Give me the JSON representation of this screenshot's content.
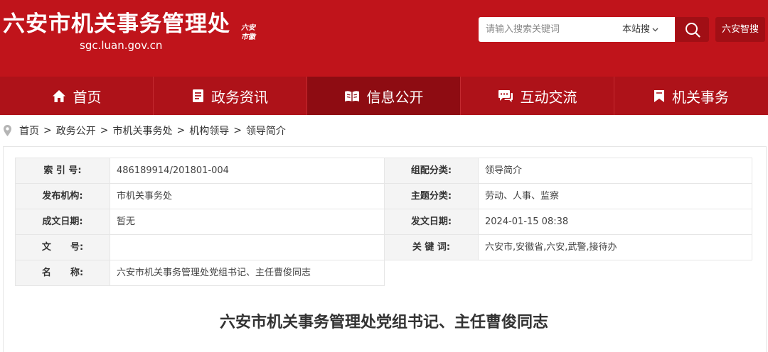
{
  "header": {
    "site_title": "六安市机关事务管理处",
    "site_domain": "sgc.luan.gov.cn",
    "seal_line1": "六安",
    "seal_line2": "市徽",
    "search": {
      "placeholder": "请输入搜索关键词",
      "scope": "本站搜",
      "smart_search_label": "六安智搜"
    },
    "brand_color": "#c0141b"
  },
  "nav": {
    "items": [
      {
        "label": "首页",
        "icon": "home-icon"
      },
      {
        "label": "政务资讯",
        "icon": "document-icon"
      },
      {
        "label": "信息公开",
        "icon": "open-book-icon"
      },
      {
        "label": "互动交流",
        "icon": "chat-icon"
      },
      {
        "label": "机关事务",
        "icon": "bookmark-icon"
      }
    ],
    "active_index": 2
  },
  "breadcrumb": {
    "items": [
      "首页",
      "政务公开",
      "市机关事务处",
      "机构领导",
      "领导简介"
    ],
    "separator": ">"
  },
  "meta": {
    "index_label": "索 引 号:",
    "index_value": "486189914/201801-004",
    "category_label": "组配分类:",
    "category_value": "领导简介",
    "publisher_label": "发布机构:",
    "publisher_value": "市机关事务处",
    "topic_label": "主题分类:",
    "topic_value": "劳动、人事、监察",
    "created_label": "成文日期:",
    "created_value": "暂无",
    "published_label": "发文日期:",
    "published_value": "2024-01-15 08:38",
    "docno_label": "文      号:",
    "docno_value": "",
    "keywords_label": "关 键 词:",
    "keywords_value": "六安市,安徽省,六安,武警,接待办",
    "name_label": "名      称:",
    "name_value": "六安市机关事务管理处党组书记、主任曹俊同志"
  },
  "article": {
    "title": "六安市机关事务管理处党组书记、主任曹俊同志"
  }
}
